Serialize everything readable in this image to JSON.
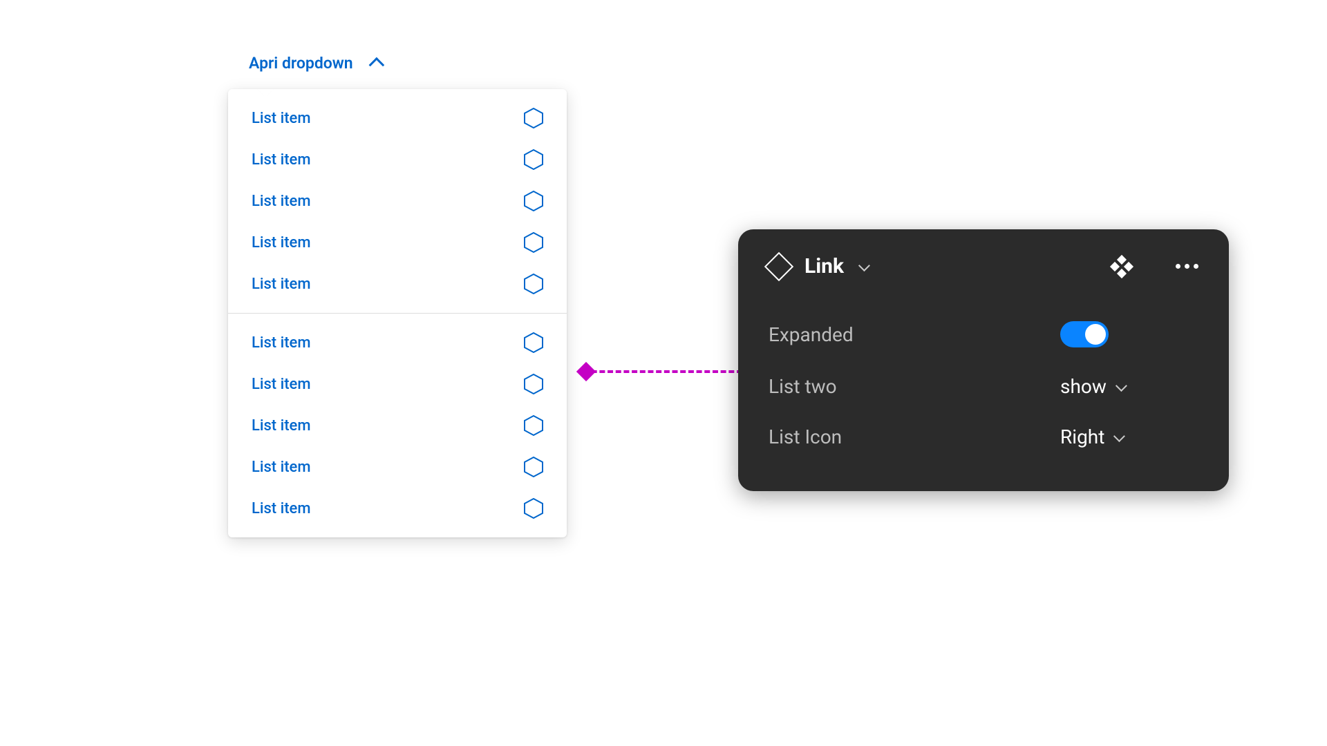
{
  "colors": {
    "link": "#0066cc",
    "connector": "#c400c4",
    "panel_bg": "#2b2b2b",
    "toggle_on": "#0a84ff"
  },
  "dropdown": {
    "trigger_label": "Apri dropdown",
    "group1": [
      {
        "label": "List item"
      },
      {
        "label": "List item"
      },
      {
        "label": "List item"
      },
      {
        "label": "List item"
      },
      {
        "label": "List item"
      }
    ],
    "group2": [
      {
        "label": "List item"
      },
      {
        "label": "List item"
      },
      {
        "label": "List item"
      },
      {
        "label": "List item"
      },
      {
        "label": "List item"
      }
    ]
  },
  "panel": {
    "title": "Link",
    "props": {
      "expanded": {
        "label": "Expanded",
        "value": true
      },
      "list_two": {
        "label": "List two",
        "value": "show"
      },
      "list_icon": {
        "label": "List Icon",
        "value": "Right"
      }
    }
  }
}
